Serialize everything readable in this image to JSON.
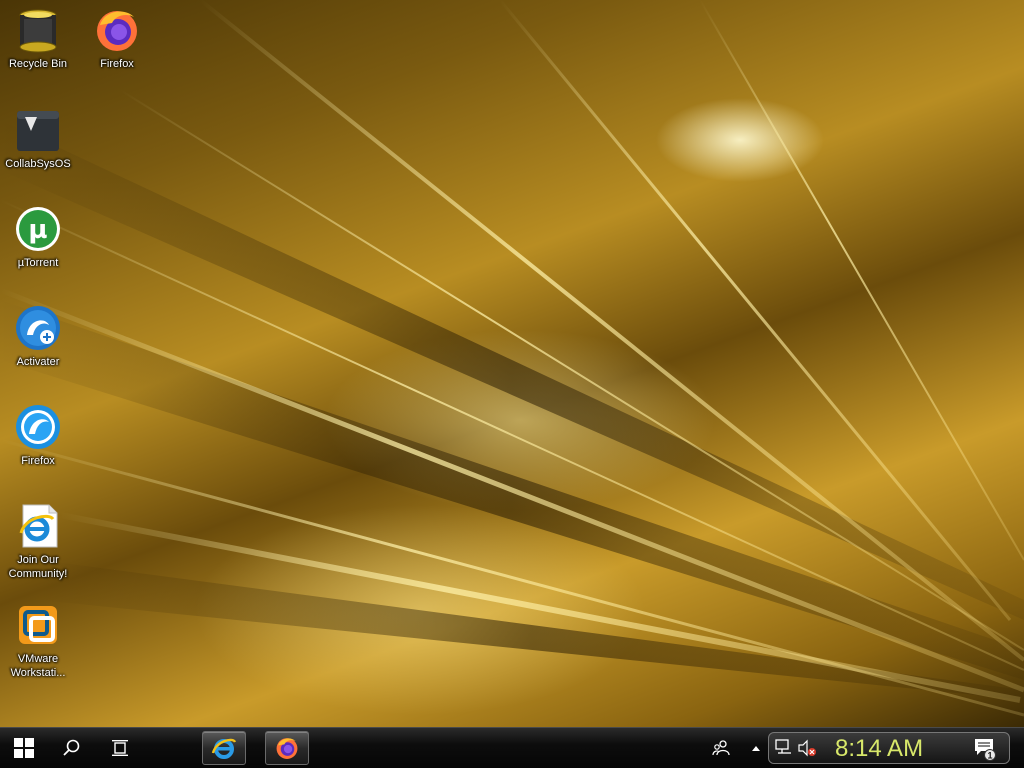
{
  "desktop_icons": [
    {
      "label": "Recycle Bin",
      "icon": "recycle-bin-icon"
    },
    {
      "label": "Firefox",
      "icon": "firefox-icon"
    },
    {
      "label": "CollabSysOS",
      "icon": "folder-icon"
    },
    {
      "label": "µTorrent",
      "icon": "utorrent-icon"
    },
    {
      "label": "Activater",
      "icon": "activator-icon"
    },
    {
      "label": "Firefox",
      "icon": "waterfox-icon"
    },
    {
      "label": "Join Our\nCommunity!",
      "icon": "internet-explorer-shortcut-icon"
    },
    {
      "label": "VMware\nWorkstati...",
      "icon": "vmware-icon"
    }
  ],
  "taskbar": {
    "start": {
      "icon": "windows-start-icon"
    },
    "search": {
      "icon": "search-icon"
    },
    "task_view": {
      "icon": "task-view-icon"
    },
    "pinned_apps": [
      {
        "name": "Internet Explorer",
        "icon": "internet-explorer-icon"
      },
      {
        "name": "Firefox",
        "icon": "firefox-icon"
      }
    ],
    "people": {
      "icon": "people-icon"
    },
    "tray": {
      "chevron_icon": "chevron-up-icon",
      "network_icon": "network-icon",
      "volume_icon": "volume-muted-icon",
      "clock": "8:14 AM",
      "notifications_icon": "notifications-icon",
      "notification_count": "1"
    }
  },
  "colors": {
    "clock_text": "#d8e86a",
    "wallpaper_gold": "#b88d22"
  }
}
